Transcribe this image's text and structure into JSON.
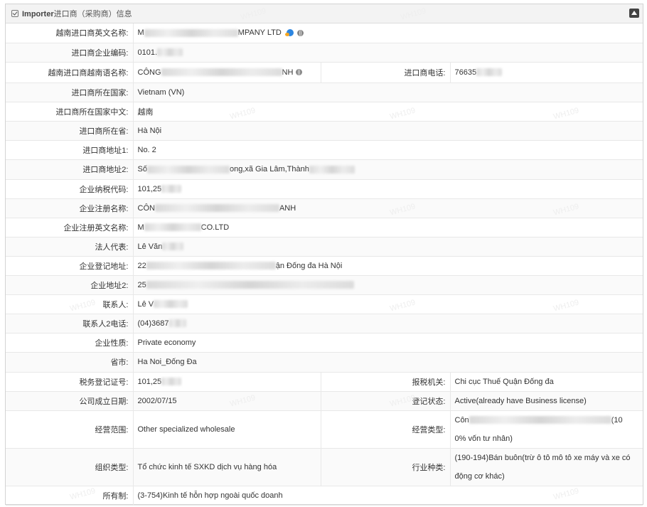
{
  "panel": {
    "title_en": "Importer",
    "title_rest": "进口商（采购商）信息"
  },
  "rows": {
    "r1": {
      "label": "越南进口商英文名称:",
      "v_a": "M",
      "v_b": "MPANY LTD"
    },
    "r2": {
      "label": "进口商企业编码:",
      "v_a": "0101."
    },
    "r3": {
      "label": "越南进口商越南语名称:",
      "v_a": "CÔNG",
      "v_b": "NH",
      "label2": "进口商电话:",
      "v2_a": "76635"
    },
    "r4": {
      "label": "进口商所在国家:",
      "value": "Vietnam (VN)"
    },
    "r5": {
      "label": "进口商所在国家中文:",
      "value": "越南"
    },
    "r6": {
      "label": "进口商所在省:",
      "value": "Hà Nội"
    },
    "r7": {
      "label": "进口商地址1:",
      "value": "No. 2"
    },
    "r8": {
      "label": "进口商地址2:",
      "v_a": "Số",
      "v_b": "ong,xã Gia Lâm,Thành"
    },
    "r9": {
      "label": "企业纳税代码:",
      "v_a": "101,25"
    },
    "r10": {
      "label": "企业注册名称:",
      "v_a": "CÔN",
      "v_b": "ANH"
    },
    "r11": {
      "label": "企业注册英文名称:",
      "v_a": "M",
      "v_b": "CO.LTD"
    },
    "r12": {
      "label": "法人代表:",
      "v_a": "Lê Văn"
    },
    "r13": {
      "label": "企业登记地址:",
      "v_a": "22",
      "v_b": "ận Đống đa Hà Nội"
    },
    "r14": {
      "label": "企业地址2:",
      "v_a": "25"
    },
    "r15": {
      "label": "联系人:",
      "v_a": "Lê V"
    },
    "r16": {
      "label": "联系人2电话:",
      "v_a": "(04)3687"
    },
    "r17": {
      "label": "企业性质:",
      "value": "Private economy"
    },
    "r18": {
      "label": "省市:",
      "value": "Ha Noi_Đống Đa"
    },
    "r19": {
      "label": "税务登记证号:",
      "v_a": "101,25",
      "label2": "报税机关:",
      "value2": "Chi cục Thuế Quận Đống đa"
    },
    "r20": {
      "label": "公司成立日期:",
      "value": "2002/07/15",
      "label2": "登记状态:",
      "value2": "Active(already have Business license)"
    },
    "r21": {
      "label": "经营范围:",
      "value": "Other specialized wholesale",
      "label2": "经营类型:",
      "v2_a": "Côn",
      "v2_b": "(10",
      "v2_c": "0% vốn tư nhân)"
    },
    "r22": {
      "label": "组织类型:",
      "value": "Tổ chức kinh tế SXKD dịch vụ hàng hóa",
      "label2": "行业种类:",
      "value2": "(190-194)Bán buôn(trừ ô tô mô tô xe máy và xe có động cơ khác)"
    },
    "r23": {
      "label": "所有制:",
      "value": "(3-754)Kinh tế hỗn hợp ngoài quốc doanh"
    }
  },
  "watermark": "WH109",
  "colors": {
    "header_bg": "#f3f3f3",
    "border": "#e8e8e8",
    "badge": "#2d86e0"
  },
  "icons": [
    "checkbox-icon",
    "collapse-icon",
    "verified-badge-icon",
    "globe-icon"
  ]
}
